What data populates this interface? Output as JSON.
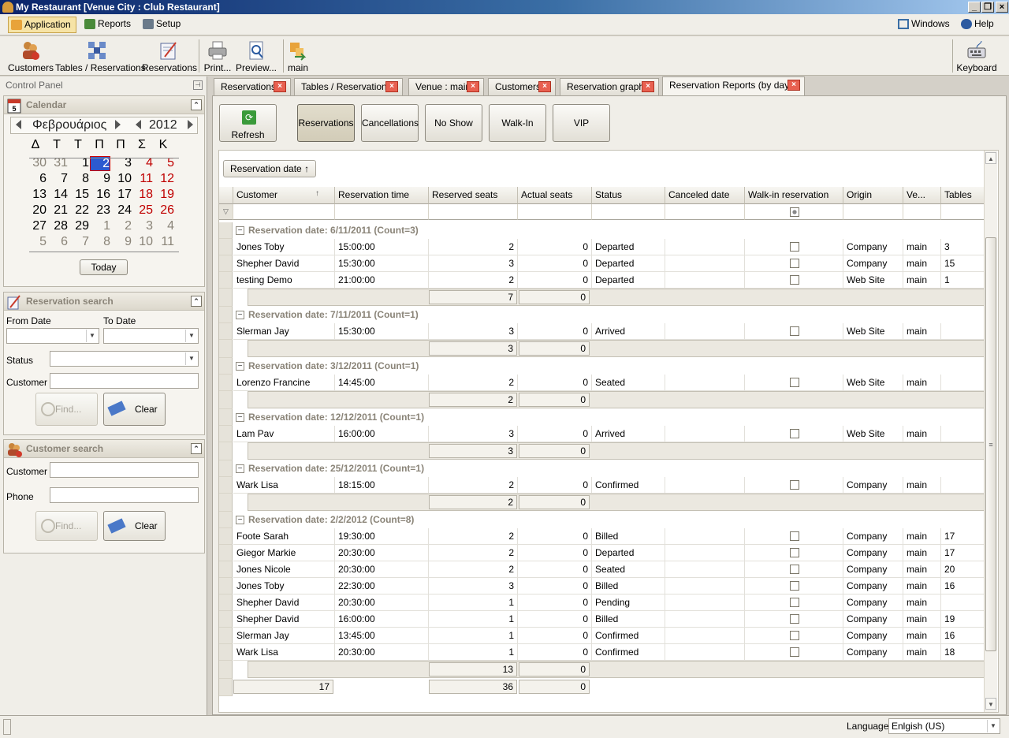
{
  "window": {
    "title": "My Restaurant [Venue City : Club Restaurant]"
  },
  "menu": {
    "application": "Application",
    "reports": "Reports",
    "setup": "Setup",
    "windows": "Windows",
    "help": "Help"
  },
  "toolbar": {
    "customers": "Customers",
    "tables": "Tables / Reservations",
    "reservations": "Reservations",
    "print": "Print...",
    "preview": "Preview...",
    "main": "main",
    "keyboard": "Keyboard"
  },
  "control_panel": {
    "title": "Control Panel"
  },
  "calendar": {
    "title": "Calendar",
    "month": "Φεβρουάριος",
    "year": "2012",
    "weekdays": [
      "Δ",
      "Τ",
      "Τ",
      "Π",
      "Π",
      "Σ",
      "Κ"
    ],
    "weeks": [
      [
        "30",
        "31",
        "1",
        "2",
        "3",
        "4",
        "5"
      ],
      [
        "6",
        "7",
        "8",
        "9",
        "10",
        "11",
        "12"
      ],
      [
        "13",
        "14",
        "15",
        "16",
        "17",
        "18",
        "19"
      ],
      [
        "20",
        "21",
        "22",
        "23",
        "24",
        "25",
        "26"
      ],
      [
        "27",
        "28",
        "29",
        "1",
        "2",
        "3",
        "4"
      ],
      [
        "5",
        "6",
        "7",
        "8",
        "9",
        "10",
        "11"
      ]
    ],
    "today_button": "Today",
    "selected_day": "2"
  },
  "reservation_search": {
    "title": "Reservation search",
    "from_date": "From Date",
    "to_date": "To Date",
    "status": "Status",
    "customer": "Customer",
    "find": "Find...",
    "clear": "Clear"
  },
  "customer_search": {
    "title": "Customer search",
    "customer": "Customer",
    "phone": "Phone",
    "find": "Find...",
    "clear": "Clear"
  },
  "tabs": [
    {
      "label": "Reservations"
    },
    {
      "label": "Tables / Reservations"
    },
    {
      "label": "Venue : main"
    },
    {
      "label": "Customers"
    },
    {
      "label": "Reservation graph"
    },
    {
      "label": "Reservation Reports (by day)"
    }
  ],
  "filters": {
    "refresh": "Refresh",
    "reservations": "Reservations",
    "cancellations": "Cancellations",
    "noshow": "No Show",
    "walkin": "Walk-In",
    "vip": "VIP"
  },
  "grid": {
    "group_by": "Reservation date",
    "columns": [
      "Customer",
      "Reservation time",
      "Reserved seats",
      "Actual seats",
      "Status",
      "Canceled date",
      "Walk-in reservation",
      "Origin",
      "Ve...",
      "Tables"
    ],
    "groups": [
      {
        "header": "Reservation date: 6/11/2011 (Count=3)",
        "rows": [
          {
            "customer": "Jones Toby",
            "time": "15:00:00",
            "reserved": "2",
            "actual": "0",
            "status": "Departed",
            "origin": "Company",
            "venue": "main",
            "tables": "3"
          },
          {
            "customer": "Shepher David",
            "time": "15:30:00",
            "reserved": "3",
            "actual": "0",
            "status": "Departed",
            "origin": "Company",
            "venue": "main",
            "tables": "15"
          },
          {
            "customer": "testing Demo",
            "time": "21:00:00",
            "reserved": "2",
            "actual": "0",
            "status": "Departed",
            "origin": "Web Site",
            "venue": "main",
            "tables": "1"
          }
        ],
        "sum_reserved": "7",
        "sum_actual": "0"
      },
      {
        "header": "Reservation date: 7/11/2011 (Count=1)",
        "rows": [
          {
            "customer": "Slerman Jay",
            "time": "15:30:00",
            "reserved": "3",
            "actual": "0",
            "status": "Arrived",
            "origin": "Web Site",
            "venue": "main",
            "tables": ""
          }
        ],
        "sum_reserved": "3",
        "sum_actual": "0"
      },
      {
        "header": "Reservation date: 3/12/2011 (Count=1)",
        "rows": [
          {
            "customer": "Lorenzo Francine",
            "time": "14:45:00",
            "reserved": "2",
            "actual": "0",
            "status": "Seated",
            "origin": "Web Site",
            "venue": "main",
            "tables": ""
          }
        ],
        "sum_reserved": "2",
        "sum_actual": "0"
      },
      {
        "header": "Reservation date: 12/12/2011 (Count=1)",
        "rows": [
          {
            "customer": "Lam Pav",
            "time": "16:00:00",
            "reserved": "3",
            "actual": "0",
            "status": "Arrived",
            "origin": "Web Site",
            "venue": "main",
            "tables": ""
          }
        ],
        "sum_reserved": "3",
        "sum_actual": "0"
      },
      {
        "header": "Reservation date: 25/12/2011 (Count=1)",
        "rows": [
          {
            "customer": "Wark Lisa",
            "time": "18:15:00",
            "reserved": "2",
            "actual": "0",
            "status": "Confirmed",
            "origin": "Company",
            "venue": "main",
            "tables": ""
          }
        ],
        "sum_reserved": "2",
        "sum_actual": "0"
      },
      {
        "header": "Reservation date: 2/2/2012 (Count=8)",
        "rows": [
          {
            "customer": "Foote Sarah",
            "time": "19:30:00",
            "reserved": "2",
            "actual": "0",
            "status": "Billed",
            "origin": "Company",
            "venue": "main",
            "tables": "17"
          },
          {
            "customer": "Giegor Markie",
            "time": "20:30:00",
            "reserved": "2",
            "actual": "0",
            "status": "Departed",
            "origin": "Company",
            "venue": "main",
            "tables": "17"
          },
          {
            "customer": "Jones Nicole",
            "time": "20:30:00",
            "reserved": "2",
            "actual": "0",
            "status": "Seated",
            "origin": "Company",
            "venue": "main",
            "tables": "20"
          },
          {
            "customer": "Jones Toby",
            "time": "22:30:00",
            "reserved": "3",
            "actual": "0",
            "status": "Billed",
            "origin": "Company",
            "venue": "main",
            "tables": "16"
          },
          {
            "customer": "Shepher David",
            "time": "20:30:00",
            "reserved": "1",
            "actual": "0",
            "status": "Pending",
            "origin": "Company",
            "venue": "main",
            "tables": ""
          },
          {
            "customer": "Shepher David",
            "time": "16:00:00",
            "reserved": "1",
            "actual": "0",
            "status": "Billed",
            "origin": "Company",
            "venue": "main",
            "tables": "19"
          },
          {
            "customer": "Slerman Jay",
            "time": "13:45:00",
            "reserved": "1",
            "actual": "0",
            "status": "Confirmed",
            "origin": "Company",
            "venue": "main",
            "tables": "16"
          },
          {
            "customer": "Wark Lisa",
            "time": "20:30:00",
            "reserved": "1",
            "actual": "0",
            "status": "Confirmed",
            "origin": "Company",
            "venue": "main",
            "tables": "18"
          }
        ],
        "sum_reserved": "13",
        "sum_actual": "0"
      }
    ],
    "total_count": "17",
    "total_reserved": "36",
    "total_actual": "0"
  },
  "statusbar": {
    "language_label": "Language",
    "language_value": "Enlgish (US)"
  }
}
